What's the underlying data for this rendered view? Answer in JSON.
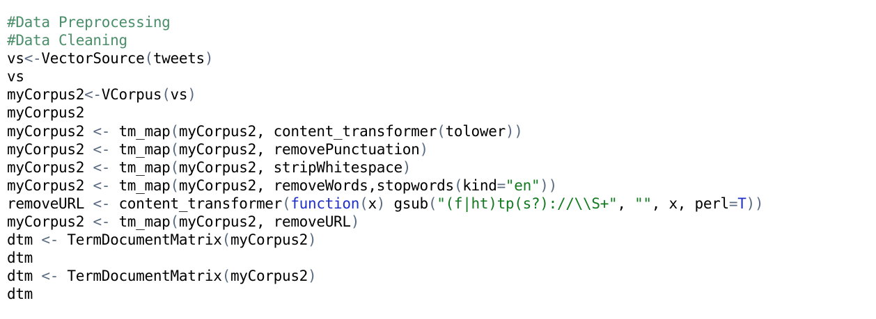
{
  "editor": {
    "colors": {
      "comment": "#4a8f6a",
      "operator": "#5a6b82",
      "keyword": "#1f30c8",
      "string": "#117a1e",
      "text": "#000000"
    },
    "lines": [
      [
        {
          "t": "#Data Preprocessing",
          "c": "comment"
        }
      ],
      [
        {
          "t": "#Data Cleaning",
          "c": "comment"
        }
      ],
      [
        {
          "t": "vs"
        },
        {
          "t": "<-",
          "c": "op"
        },
        {
          "t": "VectorSource"
        },
        {
          "t": "(",
          "c": "paren"
        },
        {
          "t": "tweets"
        },
        {
          "t": ")",
          "c": "paren"
        }
      ],
      [
        {
          "t": "vs"
        }
      ],
      [
        {
          "t": "myCorpus2"
        },
        {
          "t": "<-",
          "c": "op"
        },
        {
          "t": "VCorpus"
        },
        {
          "t": "(",
          "c": "paren"
        },
        {
          "t": "vs"
        },
        {
          "t": ")",
          "c": "paren"
        }
      ],
      [
        {
          "t": "myCorpus2"
        }
      ],
      [
        {
          "t": "myCorpus2 "
        },
        {
          "t": "<-",
          "c": "op"
        },
        {
          "t": " tm_map"
        },
        {
          "t": "(",
          "c": "paren"
        },
        {
          "t": "myCorpus2, content_transformer"
        },
        {
          "t": "(",
          "c": "paren"
        },
        {
          "t": "tolower"
        },
        {
          "t": "))",
          "c": "paren"
        }
      ],
      [
        {
          "t": "myCorpus2 "
        },
        {
          "t": "<-",
          "c": "op"
        },
        {
          "t": " tm_map"
        },
        {
          "t": "(",
          "c": "paren"
        },
        {
          "t": "myCorpus2, removePunctuation"
        },
        {
          "t": ")",
          "c": "paren"
        }
      ],
      [
        {
          "t": "myCorpus2 "
        },
        {
          "t": "<-",
          "c": "op"
        },
        {
          "t": " tm_map"
        },
        {
          "t": "(",
          "c": "paren"
        },
        {
          "t": "myCorpus2, stripWhitespace"
        },
        {
          "t": ")",
          "c": "paren"
        }
      ],
      [
        {
          "t": "myCorpus2 "
        },
        {
          "t": "<-",
          "c": "op"
        },
        {
          "t": " tm_map"
        },
        {
          "t": "(",
          "c": "paren"
        },
        {
          "t": "myCorpus2, removeWords,stopwords"
        },
        {
          "t": "(",
          "c": "paren"
        },
        {
          "t": "kind"
        },
        {
          "t": "=",
          "c": "op"
        },
        {
          "t": "\"en\"",
          "c": "string"
        },
        {
          "t": "))",
          "c": "paren"
        }
      ],
      [
        {
          "t": "removeURL "
        },
        {
          "t": "<-",
          "c": "op"
        },
        {
          "t": " content_transformer"
        },
        {
          "t": "(",
          "c": "paren"
        },
        {
          "t": "function",
          "c": "keyword"
        },
        {
          "t": "(",
          "c": "paren"
        },
        {
          "t": "x"
        },
        {
          "t": ")",
          "c": "paren"
        },
        {
          "t": " gsub"
        },
        {
          "t": "(",
          "c": "paren"
        },
        {
          "t": "\"(f|ht)tp(s?)://\\\\S+\"",
          "c": "string"
        },
        {
          "t": ", "
        },
        {
          "t": "\"\"",
          "c": "string"
        },
        {
          "t": ", x, perl"
        },
        {
          "t": "=",
          "c": "op"
        },
        {
          "t": "T",
          "c": "const"
        },
        {
          "t": "))",
          "c": "paren"
        }
      ],
      [
        {
          "t": "myCorpus2 "
        },
        {
          "t": "<-",
          "c": "op"
        },
        {
          "t": " tm_map"
        },
        {
          "t": "(",
          "c": "paren"
        },
        {
          "t": "myCorpus2, removeURL"
        },
        {
          "t": ")",
          "c": "paren"
        }
      ],
      [
        {
          "t": "dtm "
        },
        {
          "t": "<-",
          "c": "op"
        },
        {
          "t": " TermDocumentMatrix"
        },
        {
          "t": "(",
          "c": "paren"
        },
        {
          "t": "myCorpus2"
        },
        {
          "t": ")",
          "c": "paren"
        }
      ],
      [
        {
          "t": "dtm"
        }
      ],
      [
        {
          "t": "dtm "
        },
        {
          "t": "<-",
          "c": "op"
        },
        {
          "t": " TermDocumentMatrix"
        },
        {
          "t": "(",
          "c": "paren"
        },
        {
          "t": "myCorpus2"
        },
        {
          "t": ")",
          "c": "paren"
        }
      ],
      [
        {
          "t": "dtm"
        }
      ]
    ]
  }
}
